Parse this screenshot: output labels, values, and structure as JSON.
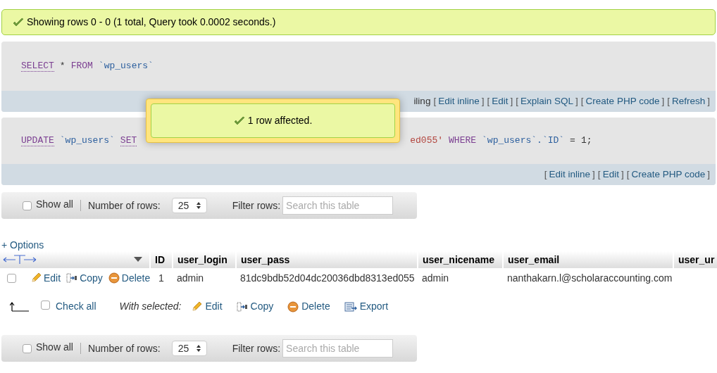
{
  "result_message": {
    "text": "Showing rows 0 - 0 (1 total, Query took 0.0002 seconds.)"
  },
  "queries": [
    {
      "tokens": [
        {
          "kind": "keyword",
          "linked": true,
          "text": "SELECT"
        },
        {
          "kind": "operator",
          "text": "*"
        },
        {
          "kind": "keyword",
          "linked": false,
          "text": "FROM"
        },
        {
          "kind": "identifier",
          "text": "`wp_users`"
        }
      ],
      "lead": "iling",
      "links": [
        {
          "open": "[",
          "label": "Edit inline",
          "close": "]"
        },
        {
          "open": "[",
          "label": "Edit",
          "close": "]"
        },
        {
          "open": "[",
          "label": "Explain SQL",
          "close": "]"
        },
        {
          "open": "[",
          "label": "Create PHP code",
          "close": "]"
        },
        {
          "open": "[",
          "label": "Refresh",
          "close": "]"
        }
      ]
    },
    {
      "tokens": [
        {
          "kind": "keyword",
          "linked": true,
          "text": "UPDATE"
        },
        {
          "kind": "identifier",
          "text": "`wp_users`"
        },
        {
          "kind": "keyword",
          "linked": true,
          "text": "SET"
        },
        {
          "kind": "covered"
        },
        {
          "kind": "string",
          "text": "ed055'"
        },
        {
          "kind": "keyword",
          "linked": false,
          "text": "WHERE"
        },
        {
          "kind": "identifier",
          "text": "`wp_users`.`ID`"
        },
        {
          "kind": "operator",
          "text": "="
        },
        {
          "kind": "number",
          "text": "1;"
        }
      ],
      "links": [
        {
          "open": "[",
          "label": "Edit inline",
          "close": "]"
        },
        {
          "open": "[",
          "label": "Edit",
          "close": "]"
        },
        {
          "open": "[",
          "label": "Create PHP code",
          "close": "]"
        }
      ]
    }
  ],
  "navigation": [
    {
      "show_all": {
        "label": "Show all",
        "checked": false
      },
      "rows_label": "Number of rows:",
      "rows_value": "25",
      "filter_label": "Filter rows:",
      "filter_placeholder": "Search this table"
    },
    {
      "show_all": {
        "label": "Show all",
        "checked": false
      },
      "rows_label": "Number of rows:",
      "rows_value": "25",
      "filter_label": "Filter rows:",
      "filter_placeholder": "Search this table"
    }
  ],
  "options_link": "+ Options",
  "table": {
    "columns": [
      "ID",
      "user_login",
      "user_pass",
      "user_nicename",
      "user_email",
      "user_ur"
    ],
    "rows": [
      {
        "selected": false,
        "actions": [
          {
            "kind": "edit",
            "label": "Edit"
          },
          {
            "kind": "copy",
            "label": "Copy"
          },
          {
            "kind": "delete",
            "label": "Delete"
          }
        ],
        "cells": [
          "1",
          "admin",
          "81dc9bdb52d04dc20036dbd8313ed055",
          "admin",
          "nanthakarn.l@scholaraccounting.com",
          ""
        ]
      }
    ]
  },
  "bulk": {
    "check_all": {
      "label": "Check all",
      "checked": false
    },
    "with_selected": "With selected:",
    "actions": [
      {
        "kind": "edit",
        "label": "Edit"
      },
      {
        "kind": "copy",
        "label": "Copy"
      },
      {
        "kind": "delete",
        "label": "Delete"
      },
      {
        "kind": "export",
        "label": "Export"
      }
    ]
  },
  "popup": {
    "text": "1 row affected."
  }
}
